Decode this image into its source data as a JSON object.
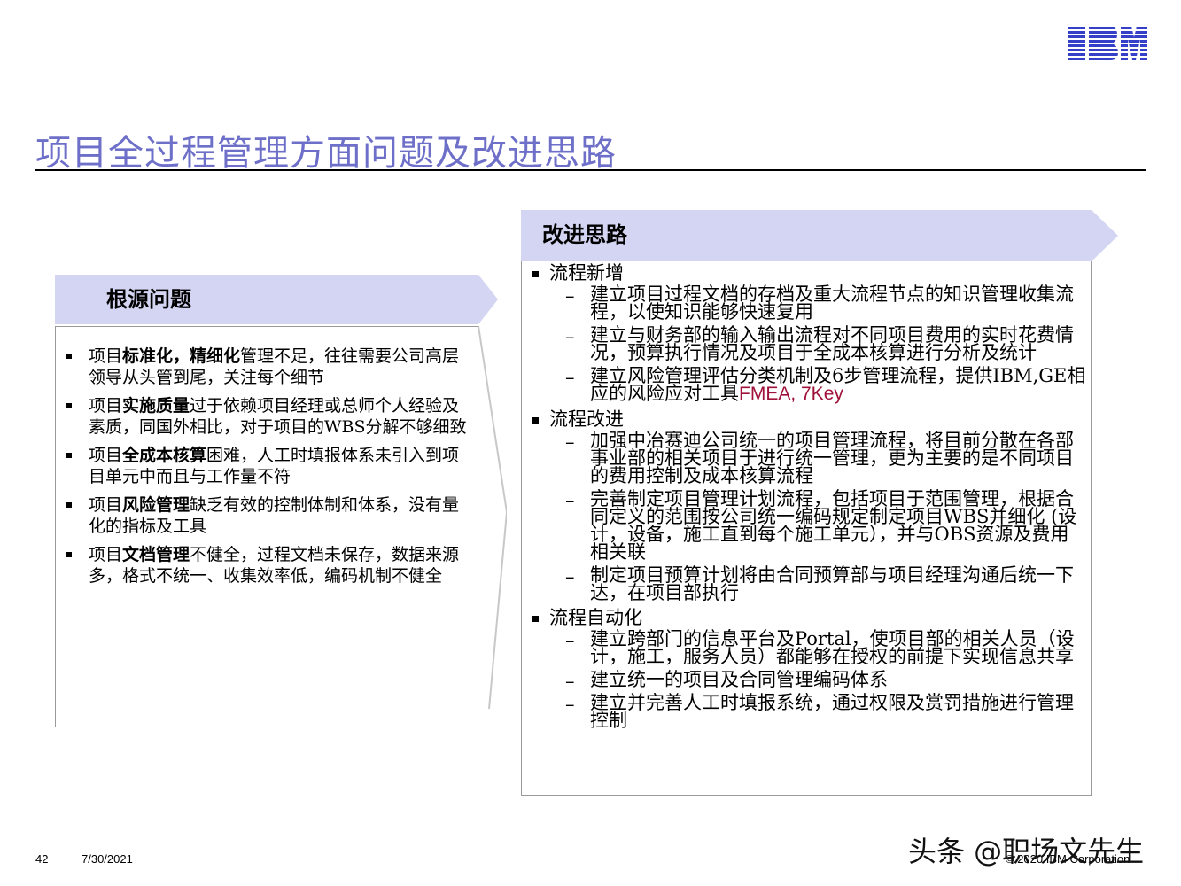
{
  "brand": {
    "logo_text": "IBM",
    "color": "#3440c8"
  },
  "title": "项目全过程管理方面问题及改进思路",
  "left_panel": {
    "heading": "根源问题",
    "items": [
      {
        "pre": "项目",
        "bold": "标准化，精细化",
        "post": "管理不足，往往需要公司高层领导从头管到尾，关注每个细节"
      },
      {
        "pre": "项目",
        "bold": "实施质量",
        "post": "过于依赖项目经理或总师个人经验及素质，同国外相比，对于项目的WBS分解不够细致"
      },
      {
        "pre": "项目",
        "bold": "全成本核算",
        "post": "困难，人工时填报体系未引入到项目单元中而且与工作量不符"
      },
      {
        "pre": "项目",
        "bold": "风险管理",
        "post": "缺乏有效的控制体制和体系，没有量化的指标及工具"
      },
      {
        "pre": "项目",
        "bold": "文档管理",
        "post": "不健全，过程文档未保存，数据来源多，格式不统一、收集效率低，编码机制不健全"
      }
    ]
  },
  "right_panel": {
    "heading": "改进思路",
    "sections": [
      {
        "label": "流程新增",
        "items": [
          {
            "text": "建立项目过程文档的存档及重大流程节点的知识管理收集流程，以使知识能够快速复用"
          },
          {
            "text": "建立与财务部的输入输出流程对不同项目费用的实时花费情况，预算执行情况及项目于全成本核算进行分析及统计"
          },
          {
            "text": "建立风险管理评估分类机制及6步管理流程，提供IBM,GE相应的风险应对工具",
            "highlight": "FMEA, 7Key"
          }
        ]
      },
      {
        "label": "流程改进",
        "items": [
          {
            "text": "加强中冶赛迪公司统一的项目管理流程，将目前分散在各部事业部的相关项目于进行统一管理，更为主要的是不同项目的费用控制及成本核算流程"
          },
          {
            "text": "完善制定项目管理计划流程，包括项目于范围管理，根据合同定义的范围按公司统一编码规定制定项目WBS并细化 (设计，设备，施工直到每个施工单元），并与OBS资源及费用相关联"
          },
          {
            "text": "制定项目预算计划将由合同预算部与项目经理沟通后统一下达，在项目部执行"
          }
        ]
      },
      {
        "label": "流程自动化",
        "items": [
          {
            "text": "建立跨部门的信息平台及Portal，使项目部的相关人员（设计，施工，服务人员）都能够在授权的前提下实现信息共享"
          },
          {
            "text": "建立统一的项目及合同管理编码体系"
          },
          {
            "text": "建立并完善人工时填报系统，通过权限及赏罚措施进行管理控制"
          }
        ]
      }
    ]
  },
  "footer": {
    "page_number": "42",
    "date": "7/30/2021",
    "copyright": "© 2020 IBM Corporation",
    "watermark": "头条 @职场文先生"
  },
  "colors": {
    "title": "#6d6fc8",
    "panel_header": "#d3d5f2",
    "highlight": "#a0113a"
  }
}
